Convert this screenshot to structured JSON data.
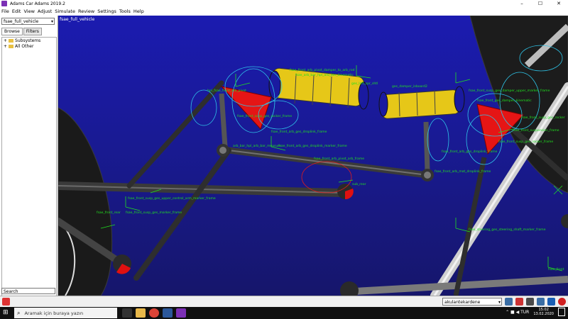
{
  "window": {
    "title": "Adams Car Adams 2019.2",
    "minimize": "–",
    "maximize": "☐",
    "close": "✕"
  },
  "menu": [
    "File",
    "Edit",
    "View",
    "Adjust",
    "Simulate",
    "Review",
    "Settings",
    "Tools",
    "Help"
  ],
  "sidebar": {
    "model": "fsae_full_vehicle",
    "tabs": [
      "Browse",
      "Filters"
    ],
    "tree": [
      {
        "expander": "+",
        "label": "Subsystems"
      },
      {
        "expander": "+",
        "label": "All Other"
      }
    ],
    "search_placeholder": "Search"
  },
  "viewport": {
    "title": "fsae_full_vehicle",
    "labels": [
      "fsae_front_arb_pivot_damper_to_arb_rod",
      "hpl_fsae_front_arb_pivot",
      "fsae_arb_bar_hpl_arb_bar_kinematic",
      "ges_left_spr_shtl",
      "ges_damper_inboard2",
      "fsae_front_susp_ges_damper_upper_marker_frame",
      "fsae_front_susp_ges_rocker",
      "fsae_front_ges_damper_kinematic",
      "fsae_front_arb_ges_droplink_frame",
      "fsae_front_susp_ges_rocker_frame",
      "fsae_front_arb_ges_droplink_marker_frame",
      "fsae_front_arb_ges_droplink_frame",
      "arb_bar_hpl_arb_bar_measure",
      "fsae_front_arb_pivot_arb_frame",
      "fsae_front_arb_mat_droplink_frame",
      "fsae_front_susp_ges_upper_control_arm_marker_frame",
      "fsae_front_susp_ges_marker_frame",
      "fsae_steering_ges_steering_shaft_marker_frame",
      "fsae_front_suspension_frame",
      "fsae_front_susp_ges_rocker_frame",
      "fsae_front_rear",
      "sub_rear",
      "fsae_front"
    ]
  },
  "bottombar": {
    "view_select": "akulantekardene",
    "icons": [
      "render-icon",
      "measure-icon",
      "grid-icon",
      "fit-icon",
      "info-icon",
      "stop-icon"
    ]
  },
  "taskbar": {
    "search_placeholder": "Aramak için buraya yazın",
    "tray_text": "⌃ ■ ◀ TUR",
    "time": "15:02",
    "date": "13.02.2020"
  }
}
